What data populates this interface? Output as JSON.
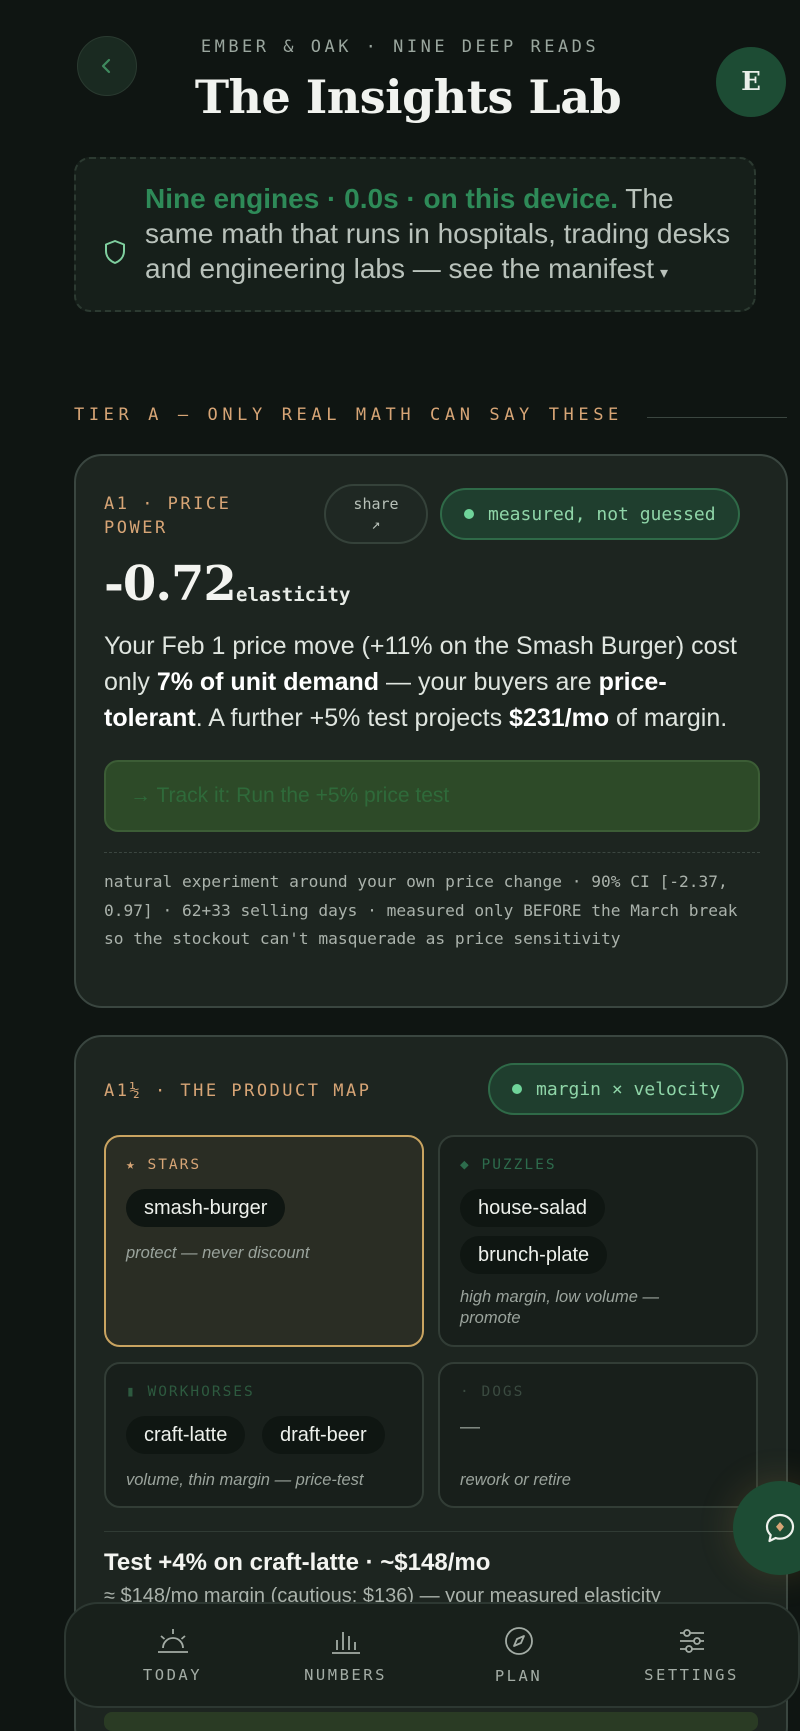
{
  "header": {
    "kicker": "EMBER & OAK · NINE DEEP READS",
    "title": "The Insights Lab",
    "avatar_initial": "E"
  },
  "manifest": {
    "highlight": "Nine engines · 0.0s · on this device.",
    "body": " The same math that runs in hospitals, trading desks and engineering labs — see the manifest",
    "caret": "▾"
  },
  "tier_a": {
    "heading": "TIER A — ONLY REAL MATH CAN SAY THESE"
  },
  "a1": {
    "label_line1": "A1 · PRICE",
    "label_line2": "POWER",
    "share_label": "share",
    "share_icon": "↗",
    "badge": "measured, not guessed",
    "value": "-0.72",
    "unit": "elasticity",
    "lead_1": "Your Feb 1 price move (+11% on the Smash Burger) cost only ",
    "lead_b1": "7% of unit demand",
    "lead_2": " — your buyers are ",
    "lead_b2": "price-tolerant",
    "lead_3": ". A further +5% test projects ",
    "lead_b3": "$231/mo",
    "lead_4": " of margin.",
    "cta": "→ Track it: Run the +5% price test",
    "footnote": "natural experiment around your own price change · 90% CI [-2.37, 0.97] · 62+33 selling days · measured only BEFORE the March break so the stockout can't masquerade as price sensitivity"
  },
  "a1b": {
    "label": "A1½ · THE PRODUCT MAP",
    "badge": "margin × velocity",
    "quadrants": {
      "stars": {
        "title": "★ STARS",
        "chips": [
          "smash-burger"
        ],
        "note": "protect — never discount"
      },
      "puzzles": {
        "title": "◆ PUZZLES",
        "chips": [
          "house-salad",
          "brunch-plate"
        ],
        "note": "high margin, low volume — promote"
      },
      "workhorses": {
        "title": "▮ WORKHORSES",
        "chips": [
          "craft-latte",
          "draft-beer"
        ],
        "note": "volume, thin margin — price-test"
      },
      "dogs": {
        "title": "· DOGS",
        "empty": "—",
        "note": "rework or retire"
      }
    },
    "headline": "Test +4% on craft-latte · ~$148/mo",
    "subline": "≈ $148/mo margin (cautious: $136) — your measured elasticity"
  },
  "nav": {
    "items": [
      "TODAY",
      "NUMBERS",
      "PLAN",
      "SETTINGS"
    ]
  },
  "colors": {
    "background": "#0f1512",
    "accent_green": "#1d4c34",
    "accent_amber": "#d7a576",
    "badge_text": "#8fd5a8"
  }
}
